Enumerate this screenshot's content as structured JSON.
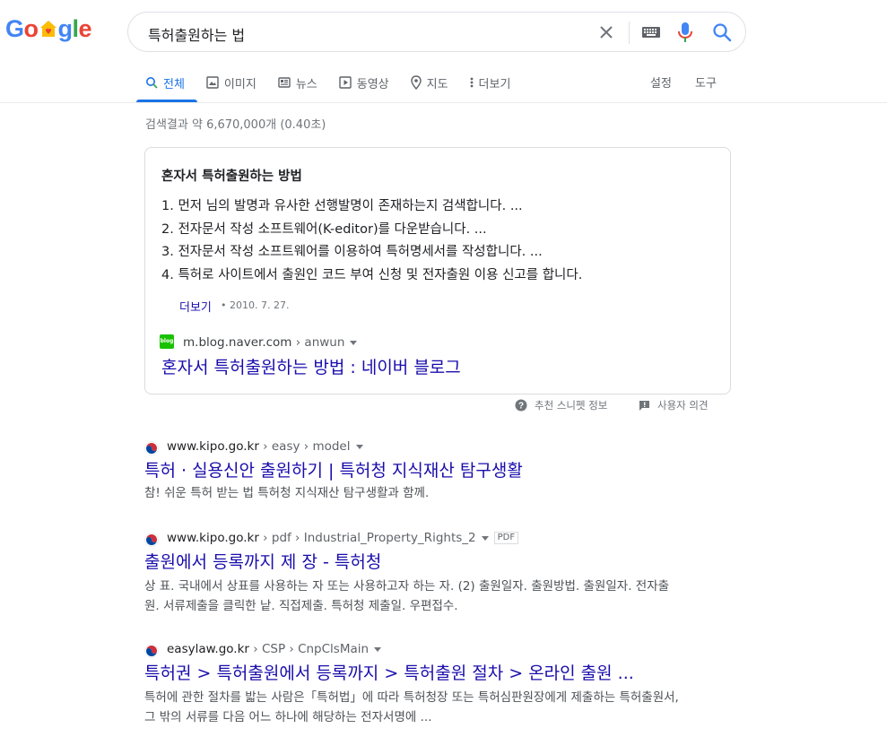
{
  "logo": {
    "letters": [
      "G",
      "o",
      "o",
      "g",
      "l",
      "e"
    ]
  },
  "search": {
    "query": "특허출원하는 법"
  },
  "tabs": [
    {
      "label": "전체",
      "icon": "search-icon"
    },
    {
      "label": "이미지",
      "icon": "image-icon"
    },
    {
      "label": "뉴스",
      "icon": "news-icon"
    },
    {
      "label": "동영상",
      "icon": "video-icon"
    },
    {
      "label": "지도",
      "icon": "map-pin-icon"
    },
    {
      "label": "더보기",
      "icon": "more-icon"
    }
  ],
  "tools": {
    "settings": "설정",
    "tools": "도구"
  },
  "stats": "검색결과 약 6,670,000개 (0.40초)",
  "snippet": {
    "title": "혼자서 특허출원하는 방법",
    "items": [
      "1. 먼저 님의 발명과 유사한 선행발명이 존재하는지 검색합니다. ...",
      "2. 전자문서 작성 소프트웨어(K-editor)를 다운받습니다. ...",
      "3. 전자문서 작성 소프트웨어를 이용하여 특허명세서를 작성합니다. ...",
      "4. 특허로 사이트에서 출원인 코드 부여 신청 및 전자출원 이용 신고를 합니다."
    ],
    "more": "더보기",
    "date": "• 2010. 7. 27.",
    "favicon_text": "blog",
    "url_domain": "m.blog.naver.com",
    "url_path": " › anwun",
    "link": "혼자서 특허출원하는 방법 : 네이버 블로그"
  },
  "feedback": {
    "about": "추천 스니펫 정보",
    "report": "사용자 의견"
  },
  "results": [
    {
      "domain": "www.kipo.go.kr",
      "path": " › easy › model",
      "title": "특허 · 실용신안 출원하기 | 특허청 지식재산 탐구생활",
      "desc": "참! 쉬운 특허 받는 법 특허청 지식재산 탐구생활과 함께."
    },
    {
      "domain": "www.kipo.go.kr",
      "path": " › pdf › Industrial_Property_Rights_2",
      "badge": "PDF",
      "title": "출원에서 등록까지 제 장 - 특허청",
      "desc": "상 표. 국내에서 상표를 사용하는 자 또는 사용하고자 하는 자. (2) 출원일자. 출원방법. 출원일자. 전자출원. 서류제출을 클릭한 낱. 직접제출. 특허청 제출일. 우편접수."
    },
    {
      "domain": "easylaw.go.kr",
      "path": " › CSP › CnpClsMain",
      "title": "특허권 > 특허출원에서 등록까지 > 특허출원 절차 > 온라인 출원 ...",
      "desc": "특허에 관한 절차를 밟는 사람은「특허법」에 따라 특허청장 또는 특허심판원장에게 제출하는 특허출원서, 그 밖의 서류를 다음 어느 하나에 해당하는 전자서명에 ..."
    }
  ],
  "colors": {
    "link": "#1a0dab",
    "accent": "#1a73e8",
    "text": "#202124",
    "muted": "#70757a"
  }
}
